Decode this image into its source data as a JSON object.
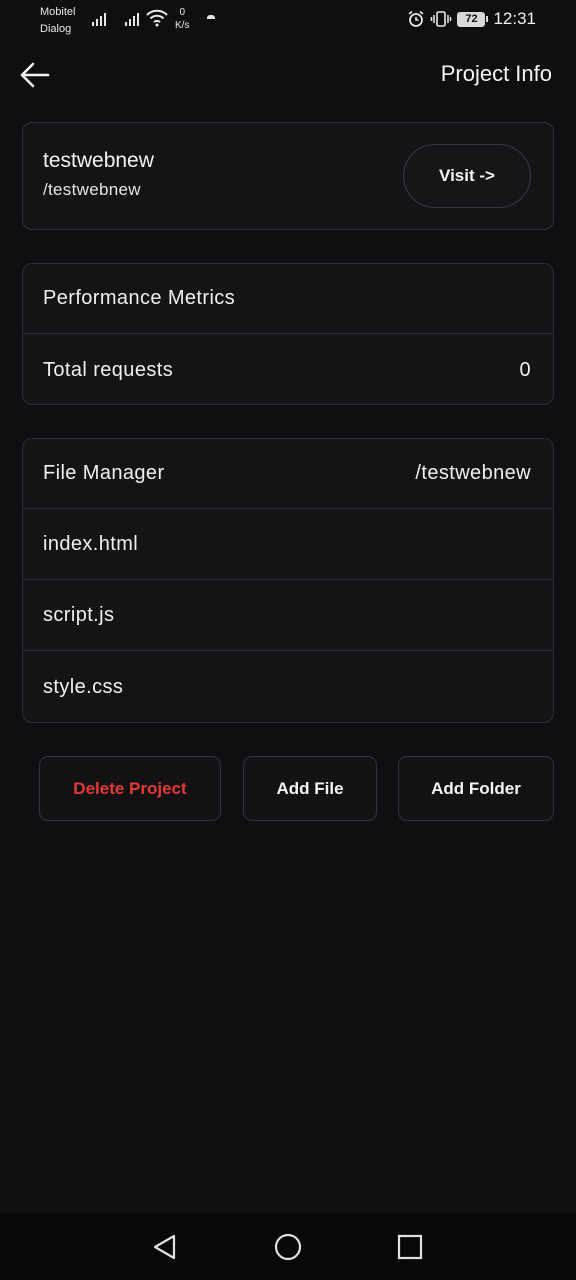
{
  "status_bar": {
    "carrier_1": "Mobitel",
    "carrier_2": "Dialog",
    "speed_value": "0",
    "speed_unit": "K/s",
    "battery": "72",
    "time": "12:31"
  },
  "header": {
    "title": "Project Info"
  },
  "project": {
    "name": "testwebnew",
    "path": "/testwebnew",
    "visit_label": "Visit  ->"
  },
  "metrics": {
    "title": "Performance Metrics",
    "rows": [
      {
        "label": "Total requests",
        "value": "0"
      }
    ]
  },
  "file_manager": {
    "title": "File Manager",
    "path": "/testwebnew",
    "files": [
      "index.html",
      "script.js",
      "style.css"
    ]
  },
  "actions": {
    "delete_label": "Delete Project",
    "add_file_label": "Add File",
    "add_folder_label": "Add Folder"
  },
  "colors": {
    "background": "#0f0f11",
    "card_border": "#2e2e33",
    "danger": "#e53935"
  },
  "icons": [
    "back-arrow-icon",
    "nav-back-icon",
    "nav-home-icon",
    "nav-recents-icon",
    "alarm-icon",
    "vibrate-icon",
    "wifi-icon",
    "signal-icon"
  ]
}
